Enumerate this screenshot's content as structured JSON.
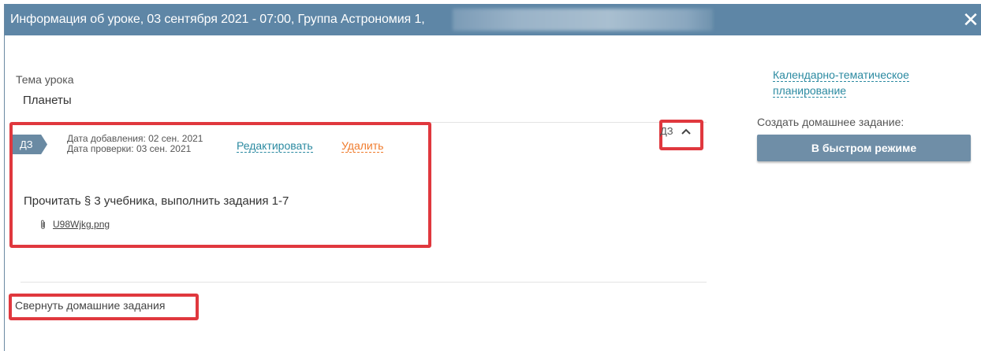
{
  "dialog": {
    "title": "Информация об уроке, 03 сентября 2021 - 07:00, Группа Астрономия 1,",
    "close_glyph": "✕"
  },
  "lesson": {
    "topic_label": "Тема урока",
    "topic_value": "Планеты"
  },
  "homework": {
    "badge": "ДЗ",
    "added_date": "Дата добавления: 02 сен. 2021",
    "check_date": "Дата проверки: 03 сен. 2021",
    "edit_label": "Редактировать",
    "delete_label": "Удалить",
    "text": "Прочитать § 3 учебника, выполнить задания 1-7",
    "attachment": "U98Wjkg.png",
    "toggle_label": "ДЗ"
  },
  "collapse_label": "Свернуть домашние задания",
  "sidebar": {
    "ktp_line1": "Календарно-тематическое",
    "ktp_line2": "планирование",
    "create_label": "Создать домашнее задание:",
    "quick_button": "В быстром режиме"
  },
  "colors": {
    "titlebar": "#5e86a6",
    "highlight": "#e0383e",
    "link": "#2b8aa1",
    "delete": "#f07b2c",
    "button": "#6f8ea7"
  }
}
